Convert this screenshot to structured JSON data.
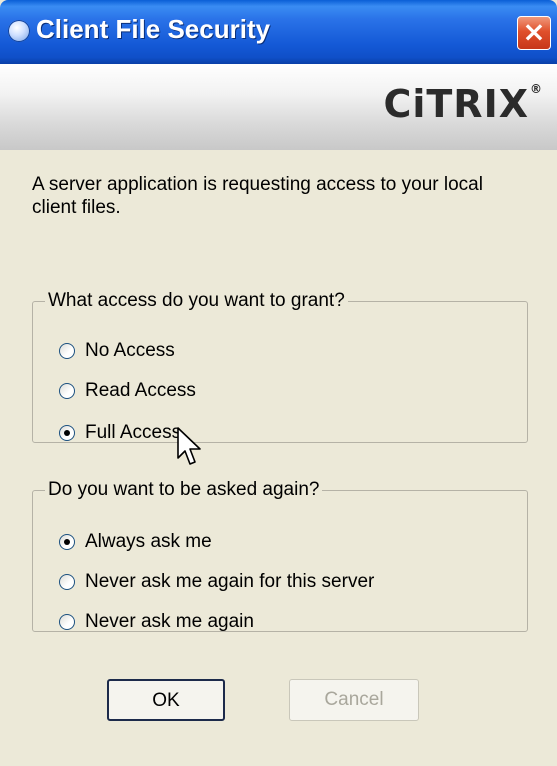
{
  "window": {
    "title": "Client File Security",
    "close_icon": "close-icon"
  },
  "banner": {
    "logo_text": "CiTRIX",
    "logo_mark": "®"
  },
  "intro_text": "A server application is requesting access to your local client files.",
  "access_group": {
    "legend": "What access do you want to grant?",
    "options": [
      {
        "label": "No Access",
        "checked": false
      },
      {
        "label": "Read Access",
        "checked": false
      },
      {
        "label": "Full Access",
        "checked": true
      }
    ]
  },
  "ask_group": {
    "legend": "Do you want to be asked again?",
    "options": [
      {
        "label": "Always ask me",
        "checked": true
      },
      {
        "label": "Never ask me again for this server",
        "checked": false
      },
      {
        "label": "Never ask me again",
        "checked": false
      }
    ]
  },
  "buttons": {
    "ok_label": "OK",
    "cancel_label": "Cancel"
  }
}
